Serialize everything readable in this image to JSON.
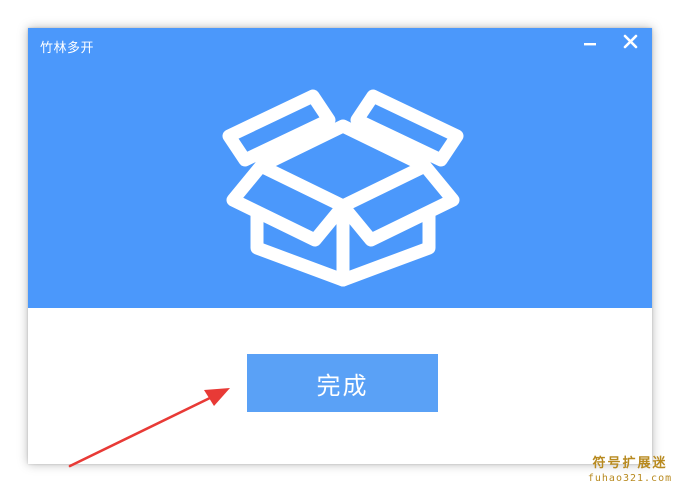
{
  "window": {
    "title": "竹林多开",
    "minimize_icon": "minimize-icon",
    "close_icon": "close-icon"
  },
  "hero": {
    "icon": "open-box-icon"
  },
  "actions": {
    "done_label": "完成"
  },
  "annotation": {
    "icon": "red-arrow-icon"
  },
  "watermark": {
    "main": "符号扩展迷",
    "sub": "fuhao321.com"
  },
  "colors": {
    "header_bg": "#4b98fb",
    "button_bg": "#5aa1f6",
    "arrow": "#e83a36",
    "watermark": "#b88a20"
  }
}
